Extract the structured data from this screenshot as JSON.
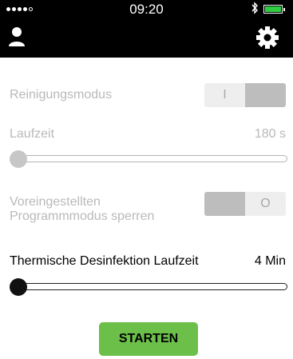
{
  "status_bar": {
    "time": "09:20"
  },
  "settings": {
    "cleaning_mode": {
      "label": "Reinigungsmodus",
      "toggle_on_label": "I"
    },
    "runtime": {
      "label": "Laufzeit",
      "value": "180 s",
      "slider_fraction": 0.0
    },
    "lock_program_mode": {
      "label_line1": "Voreingestellten",
      "label_line2": "Programmmodus sperren",
      "toggle_off_label": "O"
    },
    "thermal_disinfection": {
      "label": "Thermische Desinfektion Laufzeit",
      "value": "4 Min",
      "slider_fraction": 0.0
    }
  },
  "start_button": {
    "label": "STARTEN"
  },
  "colors": {
    "header_bg": "#000000",
    "button_green": "#6cc04a",
    "muted_text": "#b9b9b9"
  },
  "icons": {
    "user": "user-icon",
    "settings": "gear-icon",
    "bluetooth": "bluetooth-icon",
    "battery": "battery-icon"
  }
}
